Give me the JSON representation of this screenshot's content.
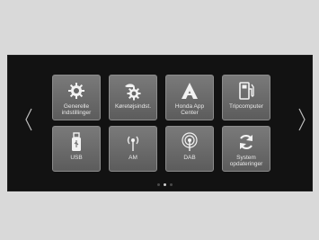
{
  "nav": {
    "prev_icon": "chevron-left-icon",
    "next_icon": "chevron-right-icon"
  },
  "tiles": [
    {
      "label": "Generelle\nindstillinger",
      "icon": "gear-icon"
    },
    {
      "label": "Køretøjsindst.",
      "icon": "vehicle-settings-icon"
    },
    {
      "label": "Honda App\nCenter",
      "icon": "honda-app-center-icon"
    },
    {
      "label": "Tripcomputer",
      "icon": "fuel-pump-icon"
    },
    {
      "label": "USB",
      "icon": "usb-icon"
    },
    {
      "label": "AM",
      "icon": "am-antenna-icon"
    },
    {
      "label": "DAB",
      "icon": "dab-antenna-icon"
    },
    {
      "label": "System\nopdateringer",
      "icon": "refresh-icon"
    }
  ],
  "pagination": {
    "pages": 3,
    "current": 2
  },
  "colors": {
    "screen_bg": "#121212",
    "tile_bg": "#6b6b6b",
    "page_bg": "#d9d9d9"
  }
}
